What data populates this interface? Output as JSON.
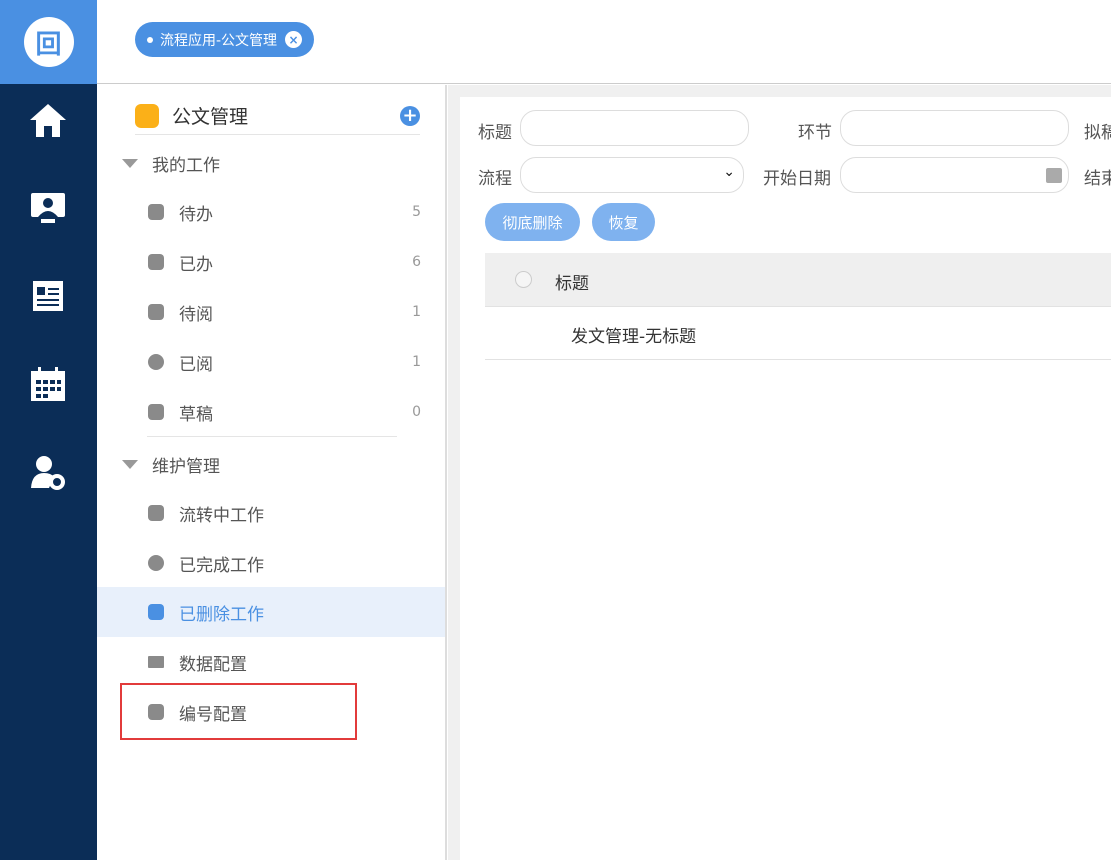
{
  "logo": {
    "glyph": "回"
  },
  "rail": {
    "icons": [
      "home-icon",
      "monitor-user-icon",
      "news-icon",
      "calendar-icon",
      "user-settings-icon"
    ]
  },
  "tab": {
    "label": "流程应用-公文管理",
    "close": "×"
  },
  "sidebar": {
    "title": "公文管理",
    "add": "+",
    "groups": [
      {
        "label": "我的工作",
        "items": [
          {
            "label": "待办",
            "count": "5"
          },
          {
            "label": "已办",
            "count": "6"
          },
          {
            "label": "待阅",
            "count": "1"
          },
          {
            "label": "已阅",
            "count": "1"
          },
          {
            "label": "草稿",
            "count": "0"
          }
        ]
      },
      {
        "label": "维护管理",
        "items": [
          {
            "label": "流转中工作"
          },
          {
            "label": "已完成工作"
          },
          {
            "label": "已删除工作"
          },
          {
            "label": "数据配置"
          },
          {
            "label": "编号配置"
          }
        ]
      }
    ]
  },
  "filters": {
    "title_label": "标题",
    "node_label": "环节",
    "draft_label": "拟稿",
    "flow_label": "流程",
    "start_label": "开始日期",
    "end_label": "结束",
    "flow_value": ""
  },
  "buttons": {
    "purge": "彻底删除",
    "restore": "恢复"
  },
  "table": {
    "columns": [
      "标题"
    ],
    "rows": [
      {
        "title": "发文管理-无标题"
      }
    ]
  },
  "colors": {
    "accent": "#4a90e2",
    "rail": "#0b2d57",
    "highlight": "#e23b3b"
  }
}
